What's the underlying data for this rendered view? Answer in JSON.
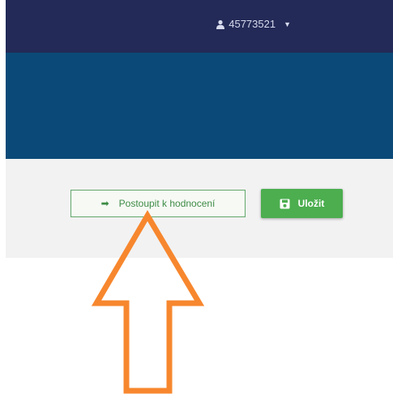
{
  "header": {
    "username": "45773521",
    "user_icon": "user-icon",
    "dropdown_icon": "caret-down-icon"
  },
  "actions": {
    "proceed_label": "Postoupit k hodnocení",
    "proceed_icon": "arrow-right-icon",
    "save_label": "Uložit",
    "save_icon": "floppy-disk-icon"
  },
  "colors": {
    "topbar": "#232a57",
    "banner": "#0b4a78",
    "accent_green": "#4cae4f",
    "annotation_orange": "#f7872e"
  }
}
